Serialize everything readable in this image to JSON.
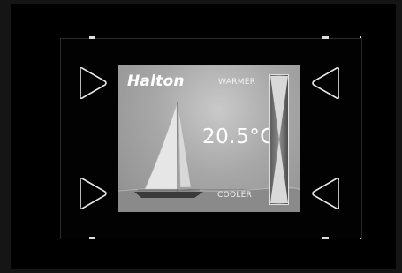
{
  "display": {
    "brand": "Halton",
    "warmer_label": "WARMER",
    "cooler_label": "COOLER",
    "temperature": "20.5°C"
  },
  "controls": {
    "top_left": "triangle-right-icon",
    "bottom_left": "triangle-right-icon",
    "top_right": "triangle-left-icon",
    "bottom_right": "triangle-left-icon"
  },
  "colors": {
    "bezel": "#000000",
    "button_outline": "#e8e8e8",
    "screen_text": "#ffffff"
  }
}
